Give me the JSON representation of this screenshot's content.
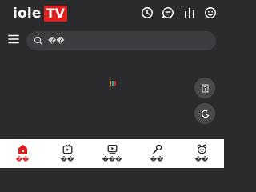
{
  "brand": {
    "name": "iole",
    "badge": "TV",
    "accent": "#e0201e"
  },
  "header_icons": [
    "history-icon",
    "message-icon",
    "ranking-icon",
    "face-icon"
  ],
  "search": {
    "placeholder": "��"
  },
  "loader_colors": [
    "#f28c28",
    "#2bb3a3",
    "#e0201e"
  ],
  "floating": {
    "top_label": "�",
    "theme_icon": "moon-icon"
  },
  "bottom_nav": [
    {
      "label": "��",
      "icon": "home-icon",
      "active": true
    },
    {
      "label": "��",
      "icon": "tv-icon",
      "active": false
    },
    {
      "label": "���",
      "icon": "video-icon",
      "active": false
    },
    {
      "label": "��",
      "icon": "mic-icon",
      "active": false
    },
    {
      "label": "��",
      "icon": "bear-icon",
      "active": false
    }
  ]
}
